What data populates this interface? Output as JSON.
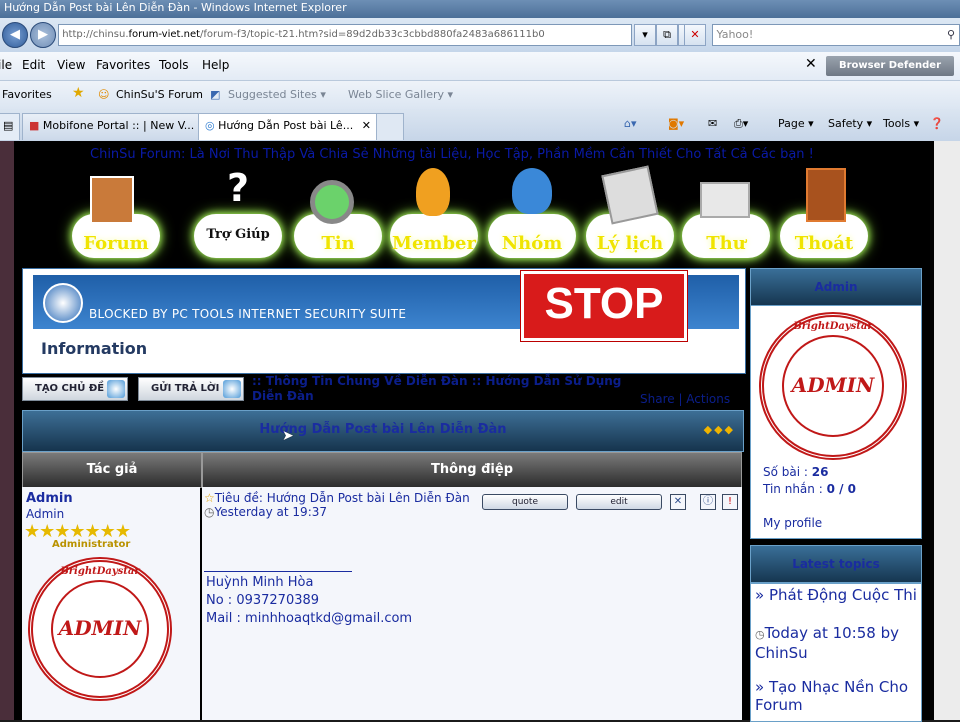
{
  "window": {
    "title": "Hướng Dẫn Post bài Lên Diễn Đàn - Windows Internet Explorer"
  },
  "address_bar": {
    "url_prefix": "http://chinsu.",
    "url_domain": "forum-viet.net",
    "url_rest": "/forum-f3/topic-t21.htm?sid=89d2db33c3cbbd880fa2483a686111b0",
    "search_placeholder": "Yahoo!"
  },
  "menu": {
    "items": [
      "File",
      "Edit",
      "View",
      "Favorites",
      "Tools",
      "Help"
    ],
    "toolbar_button": "Browser Defender"
  },
  "favorites_bar": {
    "favorites_label": "Favorites",
    "links": [
      "ChinSu'S Forum",
      "Suggested Sites ▾",
      "Web Slice Gallery ▾"
    ]
  },
  "tabs": [
    {
      "label": "Mobifone Portal :: | New V...",
      "active": false
    },
    {
      "label": "Hướng Dẫn Post bài Lê...",
      "active": true
    }
  ],
  "command_bar": [
    "Page ▾",
    "Safety ▾",
    "Tools ▾"
  ],
  "forum": {
    "tagline": "ChinSu Forum: Là Nơi Thu Thập Và Chia Sẻ Những tài Liệu, Học Tập, Phần Mềm Cần Thiết Cho Tất Cả Các bạn !",
    "nav": [
      "Forum",
      "Trợ Giúp",
      "Tin",
      "Member",
      "Nhóm",
      "Lý lịch",
      "Thư",
      "Thoát"
    ],
    "security_block": {
      "message": "BLOCKED BY PC TOOLS INTERNET SECURITY SUITE",
      "stop": "STOP",
      "info_title": "Information"
    },
    "new_topic_button": "TẠO CHỦ ĐỀ",
    "reply_button": "GỬI TRẢ LỜI",
    "breadcrumb": ":: Thông Tin Chung Về Diễn Đàn :: Hướng Dẫn Sử Dụng Diễn Đàn",
    "share_actions": "Share | Actions",
    "topic_title": "Hướng Dẫn Post bài Lên Diễn Đàn",
    "col_author": "Tác giả",
    "col_message": "Thông điệp",
    "post": {
      "author": "Admin",
      "role": "Admin",
      "stars": "★★★★★★★",
      "rank": "Administrator",
      "subject": "Tiêu đề: Hướng Dẫn Post bài Lên Diễn Đàn",
      "time": "Yesterday at 19:37",
      "buttons": [
        "quote",
        "edit"
      ],
      "signature": [
        "Huỳnh Minh Hòa",
        "No : 0937270389",
        "Mail : minhhoaqtkd@gmail.com"
      ]
    },
    "seal": {
      "main": "ADMIN",
      "ring": "BrightDaystar"
    },
    "sidebar": {
      "profile_title": "Admin",
      "posts_label": "Số bài :",
      "posts_value": "26",
      "messages_label": "Tin nhắn :",
      "messages_value": "0 / 0",
      "my_profile": "My profile",
      "latest_title": "Latest topics",
      "latest": [
        {
          "title": "» Phát Động Cuộc Thi",
          "meta": "Today at 10:58 by ChinSu"
        },
        {
          "title": "» Tạo Nhạc Nền Cho Forum",
          "meta": ""
        }
      ]
    }
  }
}
